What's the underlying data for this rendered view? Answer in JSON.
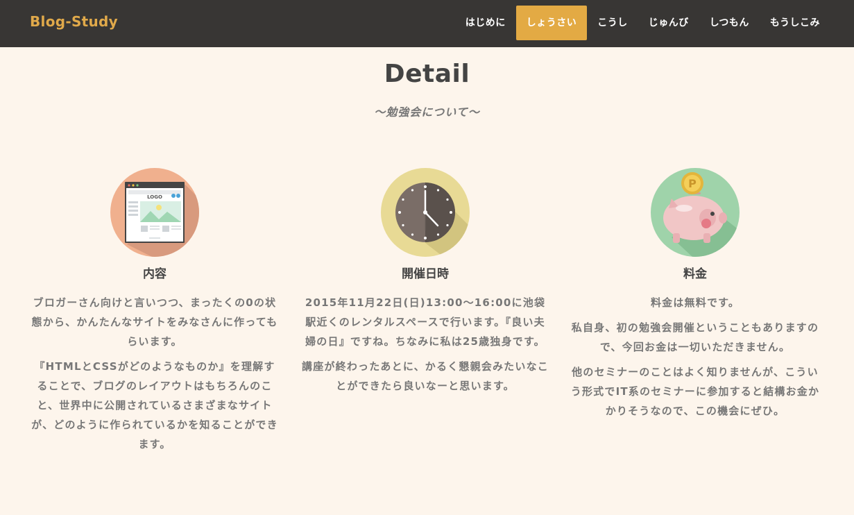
{
  "header": {
    "brand": "Blog-Study",
    "nav": [
      {
        "label": "はじめに"
      },
      {
        "label": "しょうさい"
      },
      {
        "label": "こうし"
      },
      {
        "label": "じゅんび"
      },
      {
        "label": "しつもん"
      },
      {
        "label": "もうしこみ"
      }
    ],
    "active_nav": "しょうさい"
  },
  "section": {
    "title": "Detail",
    "subtitle": "〜勉強会について〜"
  },
  "columns": [
    {
      "icon": "website-layout-icon",
      "title": "内容",
      "paragraphs": [
        "ブロガーさん向けと言いつつ、まったくの0の状態から、かんたんなサイトをみなさんに作ってもらいます。",
        "『HTMLとCSSがどのようなものか』を理解することで、ブログのレイアウトはもちろんのこと、世界中に公開されているさまざまなサイトが、どのように作られているかを知ることができます。"
      ]
    },
    {
      "icon": "clock-icon",
      "title": "開催日時",
      "paragraphs": [
        "2015年11月22日(日)13:00〜16:00に池袋駅近くのレンタルスペースで行います。『良い夫婦の日』ですね。ちなみに私は25歳独身です。",
        "講座が終わったあとに、かるく懇親会みたいなことができたら良いなーと思います。"
      ]
    },
    {
      "icon": "piggy-bank-icon",
      "title": "料金",
      "paragraphs": [
        "料金は無料です。",
        "私自身、初の勉強会開催ということもありますので、今回お金は一切いただきません。",
        "他のセミナーのことはよく知りませんが、こういう形式でIT系のセミナーに参加すると結構お金かかりそうなので、この機会にぜひ。"
      ]
    }
  ],
  "colors": {
    "navbar_bg": "#383634",
    "accent": "#e3aa44",
    "page_bg": "#fdf5ec"
  }
}
